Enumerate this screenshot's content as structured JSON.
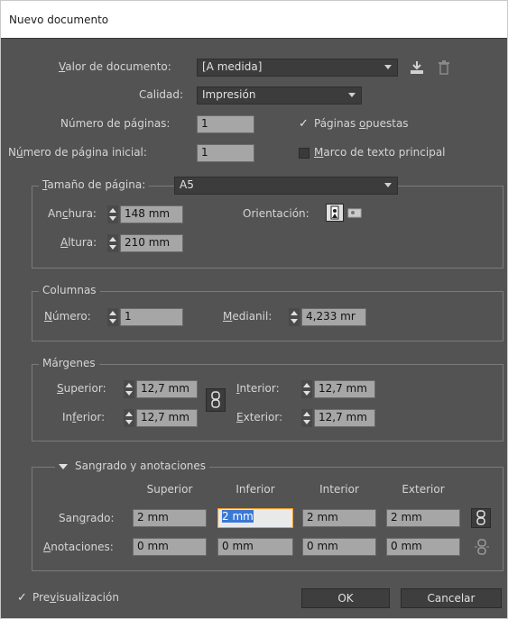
{
  "window": {
    "title": "Nuevo documento"
  },
  "document": {
    "preset_label_pre": "",
    "preset_label_u": "V",
    "preset_label_post": "alor de documento:",
    "preset_value": "[A medida]",
    "quality_label": "Calidad:",
    "quality_value": "Impresión",
    "pages_label": "Número de páginas:",
    "pages_value": "1",
    "facing_label_pre": "Páginas ",
    "facing_label_u": "o",
    "facing_label_post": "puestas",
    "start_label_pre": "N",
    "start_label_u": "ú",
    "start_label_post": "mero de página inicial:",
    "start_value": "1",
    "master_label_u": "M",
    "master_label_post": "arco de texto principal",
    "facing_checked": true,
    "master_checked": false
  },
  "page_size": {
    "legend_u": "T",
    "legend_post": "amaño de página:",
    "size_value": "A5",
    "width_label_pre": "An",
    "width_label_u": "c",
    "width_label_post": "hura:",
    "width_value": "148 mm",
    "height_label_u": "A",
    "height_label_post": "ltura:",
    "height_value": "210 mm",
    "orientation_label": "Orientación:"
  },
  "columns": {
    "legend": "Columnas",
    "number_label_u": "N",
    "number_label_post": "úmero:",
    "number_value": "1",
    "gutter_label_u": "M",
    "gutter_label_post": "edianil:",
    "gutter_value": "4,233 mr"
  },
  "margins": {
    "legend": "Márgenes",
    "top_label_u": "S",
    "top_label_post": "uperior:",
    "top_value": "12,7 mm",
    "bottom_label_pre": "In",
    "bottom_label_u": "f",
    "bottom_label_post": "erior:",
    "bottom_value": "12,7 mm",
    "inside_label_u": "I",
    "inside_label_post": "nterior:",
    "inside_value": "12,7 mm",
    "outside_label_u": "E",
    "outside_label_post": "xterior:",
    "outside_value": "12,7 mm"
  },
  "bleed": {
    "legend": "Sangrado y anotaciones",
    "headers": [
      "Superior",
      "Inferior",
      "Interior",
      "Exterior"
    ],
    "bleed_label_pre": "San",
    "bleed_label_u": "g",
    "bleed_label_post": "rado:",
    "bleed_values": [
      "2 mm",
      "2 mm",
      "2 mm",
      "2 mm"
    ],
    "slug_label_u": "A",
    "slug_label_post": "notaciones:",
    "slug_values": [
      "0 mm",
      "0 mm",
      "0 mm",
      "0 mm"
    ]
  },
  "footer": {
    "preview_label_pre": "Pre",
    "preview_label_u": "v",
    "preview_label_post": "isualización",
    "preview_checked": true,
    "ok_label": "OK",
    "cancel_label": "Cancelar"
  },
  "colors": {
    "panel_bg": "#535353",
    "field_bg": "#a6a6a6",
    "active_border": "#f0a030",
    "selection": "#3a78d6"
  }
}
